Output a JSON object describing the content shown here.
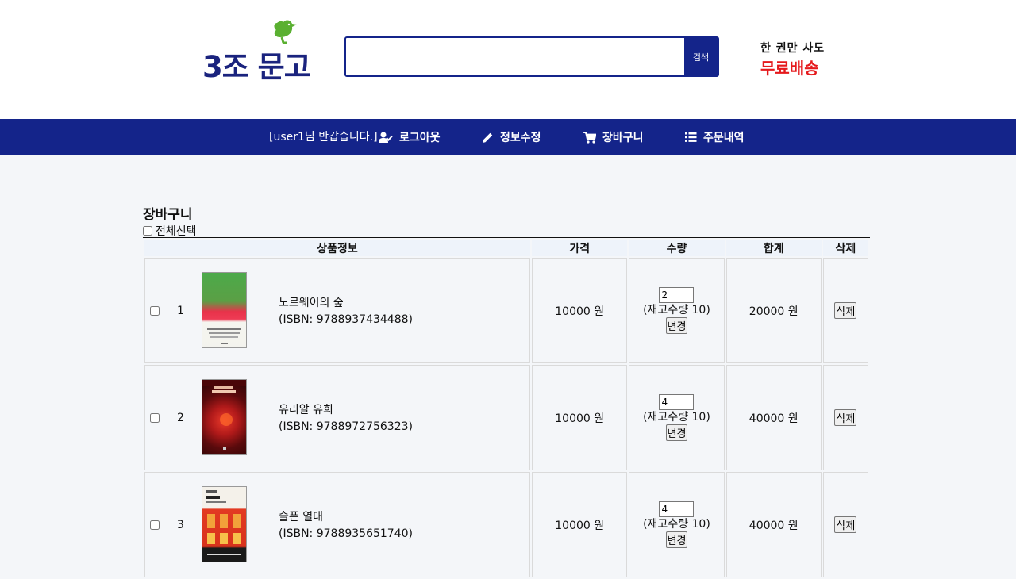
{
  "header": {
    "logo_text": "3조 문고",
    "search_placeholder": "",
    "search_value": "",
    "search_button": "검색",
    "promo_line1": "한 권만 사도",
    "promo_line2": "무료배송"
  },
  "nav": {
    "welcome": "[user1님 반갑습니다.]",
    "logout": "로그아웃",
    "edit_profile": "정보수정",
    "cart": "장바구니",
    "orders": "주문내역"
  },
  "cart": {
    "title": "장바구니",
    "select_all": "전체선택",
    "columns": [
      "상품정보",
      "가격",
      "수량",
      "합계",
      "삭제"
    ],
    "items": [
      {
        "num": "1",
        "title": "노르웨이의 숲",
        "isbn": "(ISBN: 9788937434488)",
        "price": "10000 원",
        "qty": "2",
        "stock": "(재고수량 10)",
        "change": "변경",
        "total": "20000 원",
        "delete": "삭제",
        "cover": "green-red"
      },
      {
        "num": "2",
        "title": "유리알 유희",
        "isbn": "(ISBN: 9788972756323)",
        "price": "10000 원",
        "qty": "4",
        "stock": "(재고수량 10)",
        "change": "변경",
        "total": "40000 원",
        "delete": "삭제",
        "cover": "dark-red"
      },
      {
        "num": "3",
        "title": "슬픈 열대",
        "isbn": "(ISBN: 9788935651740)",
        "price": "10000 원",
        "qty": "4",
        "stock": "(재고수량 10)",
        "change": "변경",
        "total": "40000 원",
        "delete": "삭제",
        "cover": "red-pattern"
      }
    ]
  },
  "colors": {
    "brand_navy": "#14248a",
    "promo_red": "#e5191c",
    "logo_green": "#5ab031"
  },
  "icons": {
    "logout": "user-check-icon",
    "edit": "pencil-icon",
    "cart": "shopping-cart-icon",
    "orders": "list-icon",
    "logo": "bird-icon"
  }
}
